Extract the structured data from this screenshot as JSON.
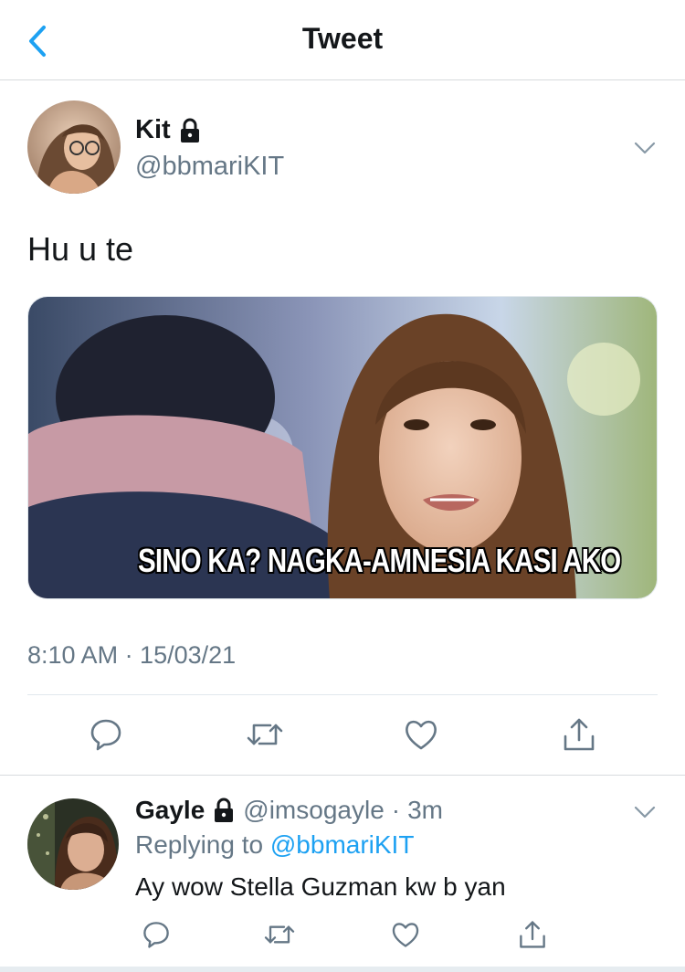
{
  "header": {
    "title": "Tweet",
    "back_icon": "chevron-left-icon"
  },
  "tweet": {
    "author": {
      "name": "Kit",
      "handle": "@bbmariKIT",
      "protected": true
    },
    "text": "Hu u te",
    "media": {
      "caption": "SINO KA? NAGKA-AMNESIA KASI AKO"
    },
    "timestamp": "8:10 AM · 15/03/21",
    "actions": [
      "reply-icon",
      "retweet-icon",
      "like-icon",
      "share-icon"
    ]
  },
  "reply": {
    "author": {
      "name": "Gayle",
      "handle": "@imsogayle",
      "protected": true
    },
    "separator": "·",
    "time": "3m",
    "replying_label": "Replying to",
    "replying_to": "@bbmariKIT",
    "text": "Ay wow Stella Guzman kw b yan",
    "actions": [
      "reply-icon",
      "retweet-icon",
      "like-icon",
      "share-icon"
    ]
  },
  "colors": {
    "accent": "#1da1f2",
    "secondary_text": "#657786",
    "primary_text": "#14171a",
    "divider": "#e1e8ed"
  }
}
